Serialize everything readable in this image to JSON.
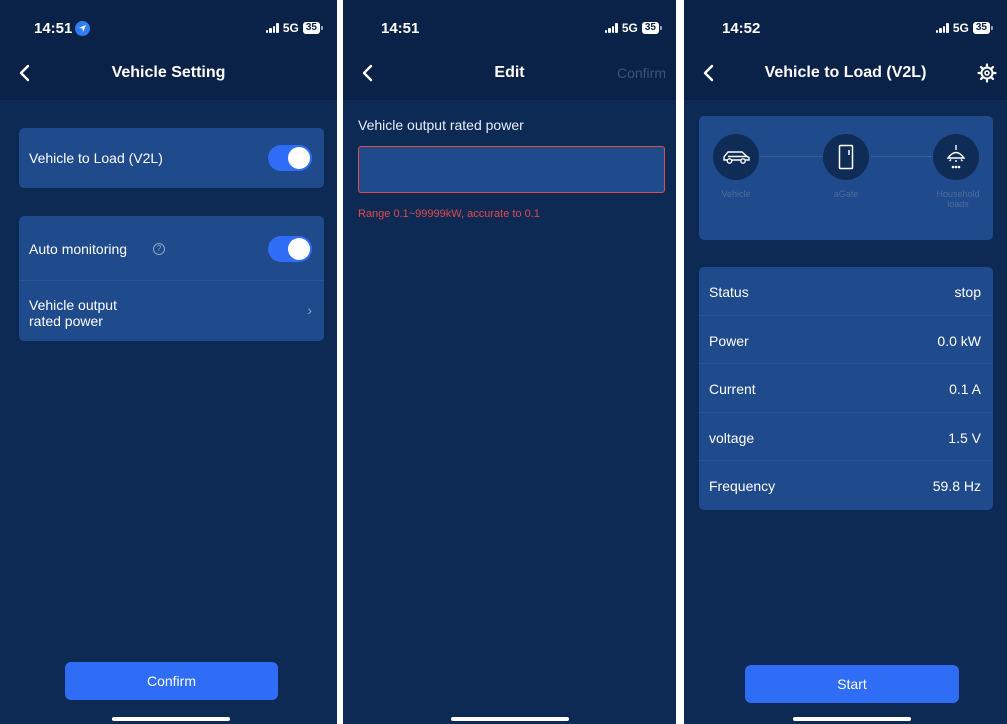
{
  "screens": [
    {
      "status": {
        "time": "14:51",
        "network": "5G",
        "battery": "35"
      },
      "nav": {
        "title": "Vehicle Setting"
      },
      "v2l_label": "Vehicle to Load (V2L)",
      "v2l_toggle": "on",
      "auto_monitoring_label": "Auto monitoring",
      "auto_monitoring_toggle": "on",
      "rated_power_label": "Vehicle output rated power",
      "confirm_label": "Confirm"
    },
    {
      "status": {
        "time": "14:51",
        "network": "5G",
        "battery": "35"
      },
      "nav": {
        "title": "Edit",
        "confirm_label": "Confirm"
      },
      "field_label": "Vehicle output rated power",
      "input_value": "",
      "range_hint": "Range 0.1~99999kW, accurate to 0.1"
    },
    {
      "status": {
        "time": "14:52",
        "network": "5G",
        "battery": "35"
      },
      "nav": {
        "title": "Vehicle to Load (V2L)"
      },
      "diagram": {
        "nodes": [
          {
            "label": "Vehicle",
            "icon": "car-icon"
          },
          {
            "label": "aGate",
            "icon": "agate-icon"
          },
          {
            "label": "Household loads",
            "icon": "lamp-icon"
          }
        ]
      },
      "info_rows": [
        {
          "label": "Status",
          "value": "stop"
        },
        {
          "label": "Power",
          "value": "0.0 kW"
        },
        {
          "label": "Current",
          "value": "0.1 A"
        },
        {
          "label": "voltage",
          "value": "1.5 V"
        },
        {
          "label": "Frequency",
          "value": "59.8 Hz"
        }
      ],
      "start_label": "Start"
    }
  ],
  "colors": {
    "background": "#0d2a55",
    "card": "#1f4a8c",
    "accent": "#2f6df6",
    "error": "#e14a4a"
  }
}
